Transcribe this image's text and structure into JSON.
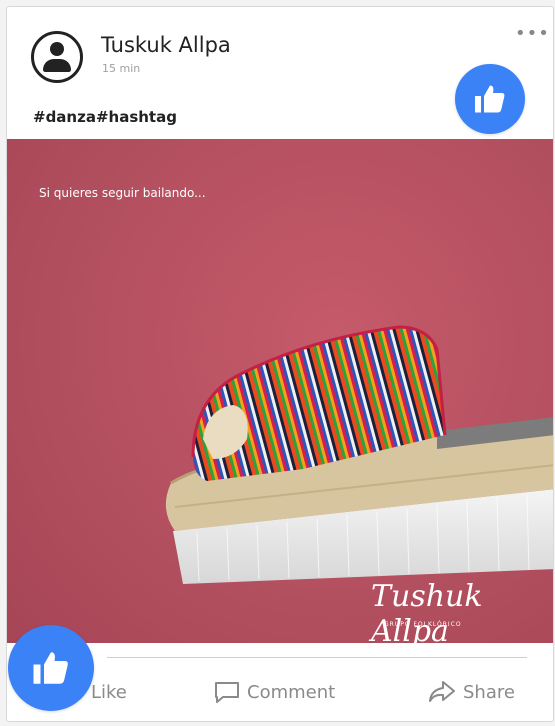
{
  "post": {
    "author": "Tuskuk Allpa",
    "time": "15 min",
    "more_label": "•••",
    "hashtags": "#danza#hashtag"
  },
  "image": {
    "caption": "Si quieres seguir bailando...",
    "brand_text": "Tushuk Allpa",
    "brand_subtext": "GRUPO FOLKLÓRICO"
  },
  "actions": {
    "like_label": "Like",
    "comment_label": "Comment",
    "share_label": "Share"
  },
  "colors": {
    "accent": "#3b82f6",
    "photo_background": "#b24f5f"
  },
  "icons": {
    "avatar": "user-avatar-icon",
    "more": "more-dots-icon",
    "like": "thumbs-up-icon",
    "comment": "comment-bubble-icon",
    "share": "share-arrow-icon"
  }
}
